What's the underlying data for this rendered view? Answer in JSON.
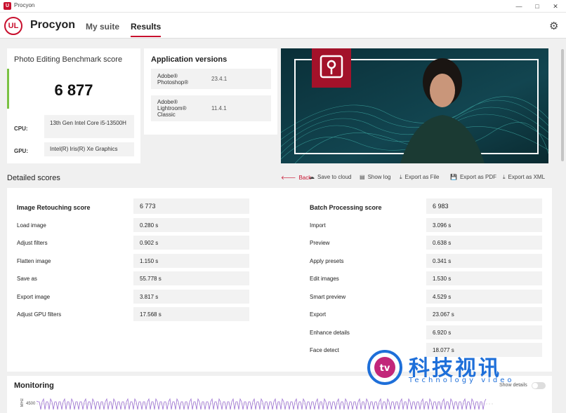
{
  "window": {
    "title": "Procyon",
    "icon": "ul-app-icon"
  },
  "header": {
    "logo": "UL",
    "app_name": "Procyon",
    "tabs": [
      {
        "label": "My suite"
      },
      {
        "label": "Results"
      }
    ],
    "settings_icon": "gear-icon"
  },
  "score_card": {
    "title": "Photo Editing Benchmark score",
    "score": "6 877",
    "cpu_label": "CPU:",
    "cpu_value": "13th Gen Intel Core i5-13500H",
    "gpu_label": "GPU:",
    "gpu_value": "Intel(R) Iris(R) Xe Graphics"
  },
  "app_versions": {
    "title": "Application versions",
    "items": [
      {
        "name": "Adobe® Photoshop®",
        "version": "23.4.1"
      },
      {
        "name": "Adobe® Lightroom® Classic",
        "version": "11.4.1"
      }
    ]
  },
  "detailed": {
    "title": "Detailed scores",
    "actions": [
      {
        "label": "Back",
        "icon": "arrow-left-icon"
      },
      {
        "label": "Save to cloud",
        "icon": "cloud-icon"
      },
      {
        "label": "Show log",
        "icon": "document-icon"
      },
      {
        "label": "Export as File",
        "icon": "download-icon"
      },
      {
        "label": "Export as PDF",
        "icon": "save-icon"
      },
      {
        "label": "Export as XML",
        "icon": "download-icon"
      }
    ],
    "left": {
      "header": {
        "label": "Image Retouching score",
        "value": "6 773"
      },
      "rows": [
        {
          "label": "Load image",
          "value": "0.280 s"
        },
        {
          "label": "Adjust filters",
          "value": "0.902 s"
        },
        {
          "label": "Flatten image",
          "value": "1.150 s"
        },
        {
          "label": "Save as",
          "value": "55.778 s"
        },
        {
          "label": "Export image",
          "value": "3.817 s"
        },
        {
          "label": "Adjust GPU filters",
          "value": "17.568 s"
        }
      ]
    },
    "right": {
      "header": {
        "label": "Batch Processing score",
        "value": "6 983"
      },
      "rows": [
        {
          "label": "Import",
          "value": "3.096 s"
        },
        {
          "label": "Preview",
          "value": "0.638 s"
        },
        {
          "label": "Apply presets",
          "value": "0.341 s"
        },
        {
          "label": "Edit images",
          "value": "1.530 s"
        },
        {
          "label": "Smart preview",
          "value": "4.529 s"
        },
        {
          "label": "Export",
          "value": "23.067 s"
        },
        {
          "label": "Enhance details",
          "value": "6.920 s"
        },
        {
          "label": "Face detect",
          "value": "18.077 s"
        }
      ]
    }
  },
  "monitoring": {
    "title": "Monitoring",
    "show_details": "Show details",
    "y_tick": "4500",
    "y_unit": "MHz"
  },
  "watermark": {
    "cn": "科技视讯",
    "en": "Technology video"
  },
  "colors": {
    "accent": "#c8102e",
    "score_bar": "#7ac143",
    "chart": "#9b6fd1"
  }
}
